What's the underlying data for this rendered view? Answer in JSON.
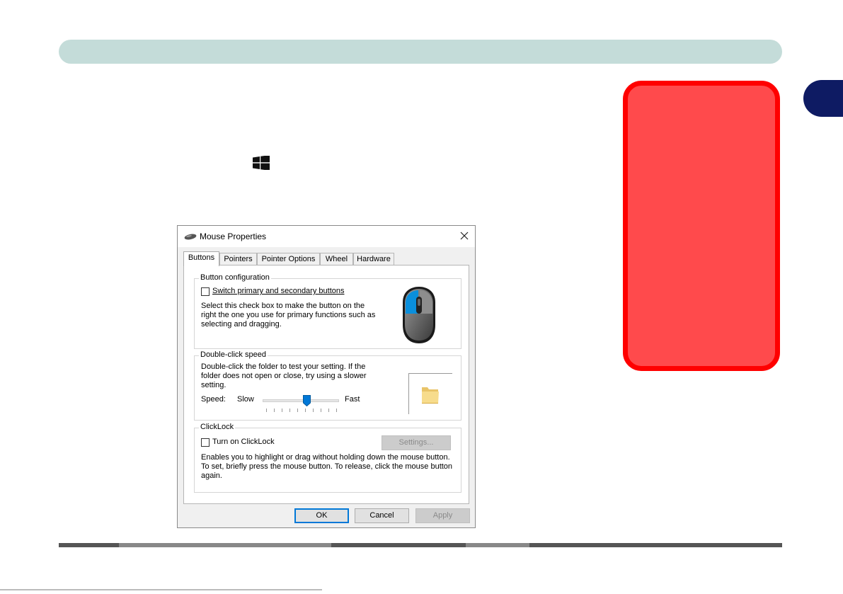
{
  "dialog": {
    "title": "Mouse Properties",
    "tabs": [
      {
        "label": "Buttons",
        "active": true
      },
      {
        "label": "Pointers"
      },
      {
        "label": "Pointer Options"
      },
      {
        "label": "Wheel"
      },
      {
        "label": "Hardware"
      }
    ],
    "button_configuration": {
      "legend": "Button configuration",
      "checkbox_label": "Switch primary and secondary buttons",
      "checked": false,
      "description": "Select this check box to make the button on the right the one you use for primary functions such as selecting and dragging."
    },
    "double_click_speed": {
      "legend": "Double-click speed",
      "description": "Double-click the folder to test your setting. If the folder does not open or close, try using a slower setting.",
      "speed_label": "Speed:",
      "slow_label": "Slow",
      "fast_label": "Fast",
      "slider_level": 0.58
    },
    "clicklock": {
      "legend": "ClickLock",
      "checkbox_label": "Turn on ClickLock",
      "checked": false,
      "settings_button": "Settings...",
      "description": "Enables you to highlight or drag without holding down the mouse button. To set, briefly press the mouse button. To release, click the mouse button again."
    },
    "buttons": {
      "ok": "OK",
      "cancel": "Cancel",
      "apply": "Apply"
    }
  },
  "colors": {
    "header_bar": "#c4dcd9",
    "chapter_tab": "#0e1b63",
    "note_box_fill": "#ff4a4c",
    "note_box_border": "#ff0000",
    "accent": "#0078d7"
  },
  "icons": [
    "windows-logo-icon",
    "mouse-device-icon",
    "close-icon",
    "mouse-illustration-icon",
    "folder-icon",
    "slider-thumb-icon"
  ]
}
